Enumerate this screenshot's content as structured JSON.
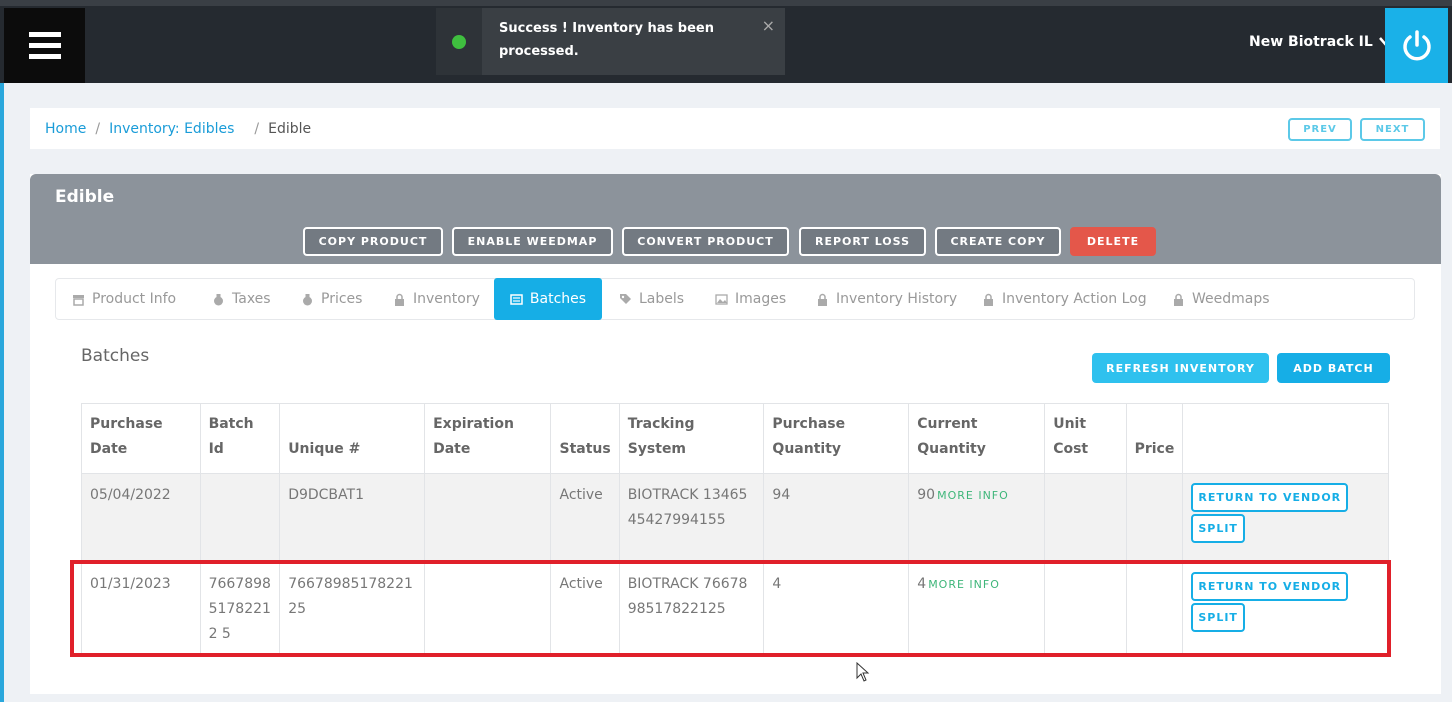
{
  "topbar": {
    "toast_message": "Success ! Inventory has been processed.",
    "toast_close": "×",
    "store_name": "New Biotrack IL",
    "colors": {
      "bar": "#252a30",
      "power": "#1ab1e8",
      "success_dot": "#3fbf3f"
    }
  },
  "breadcrumb": {
    "home": "Home",
    "category": "Inventory: Edibles",
    "current": "Edible",
    "prev": "PREV",
    "next": "NEXT"
  },
  "product": {
    "title": "Edible",
    "actions": {
      "copy_product": "COPY PRODUCT",
      "enable_weedmap": "ENABLE WEEDMAP",
      "convert_product": "CONVERT PRODUCT",
      "report_loss": "REPORT LOSS",
      "create_copy": "CREATE COPY",
      "delete": "DELETE"
    }
  },
  "tabs": [
    {
      "label": "Product Info",
      "icon": "store-icon"
    },
    {
      "label": "Taxes",
      "icon": "moneybag-icon"
    },
    {
      "label": "Prices",
      "icon": "moneybag-icon"
    },
    {
      "label": "Inventory",
      "icon": "lock-icon"
    },
    {
      "label": "Batches",
      "icon": "batches-icon",
      "active": true
    },
    {
      "label": "Labels",
      "icon": "tag-icon"
    },
    {
      "label": "Images",
      "icon": "image-icon"
    },
    {
      "label": "Inventory History",
      "icon": "lock-icon"
    },
    {
      "label": "Inventory Action Log",
      "icon": "lock-icon"
    },
    {
      "label": "Weedmaps",
      "icon": "lock-icon"
    }
  ],
  "batches": {
    "title": "Batches",
    "refresh_label": "REFRESH INVENTORY",
    "add_label": "ADD BATCH",
    "columns": {
      "purchase_date": "Purchase Date",
      "batch_id": "Batch Id",
      "unique": "Unique #",
      "expiration_date": "Expiration Date",
      "status": "Status",
      "tracking_system": "Tracking System",
      "purchase_quantity": "Purchase Quantity",
      "current_quantity": "Current Quantity",
      "unit_cost": "Unit Cost",
      "price": "Price"
    },
    "more_info_label": "MORE INFO",
    "return_label": "RETURN TO VENDOR",
    "split_label": "SPLIT",
    "rows": [
      {
        "purchase_date": "05/04/2022",
        "batch_id": "",
        "unique": "D9DCBAT1",
        "expiration_date": "",
        "status": "Active",
        "tracking_system": "BIOTRACK 1346545427994155",
        "purchase_quantity": "94",
        "current_quantity": "90",
        "unit_cost": "",
        "price": ""
      },
      {
        "purchase_date": "01/31/2023",
        "batch_id": "766789851782212 5",
        "unique": "7667898517822125",
        "expiration_date": "",
        "status": "Active",
        "tracking_system": "BIOTRACK 7667898517822125",
        "purchase_quantity": "4",
        "current_quantity": "4",
        "unit_cost": "",
        "price": ""
      }
    ]
  }
}
